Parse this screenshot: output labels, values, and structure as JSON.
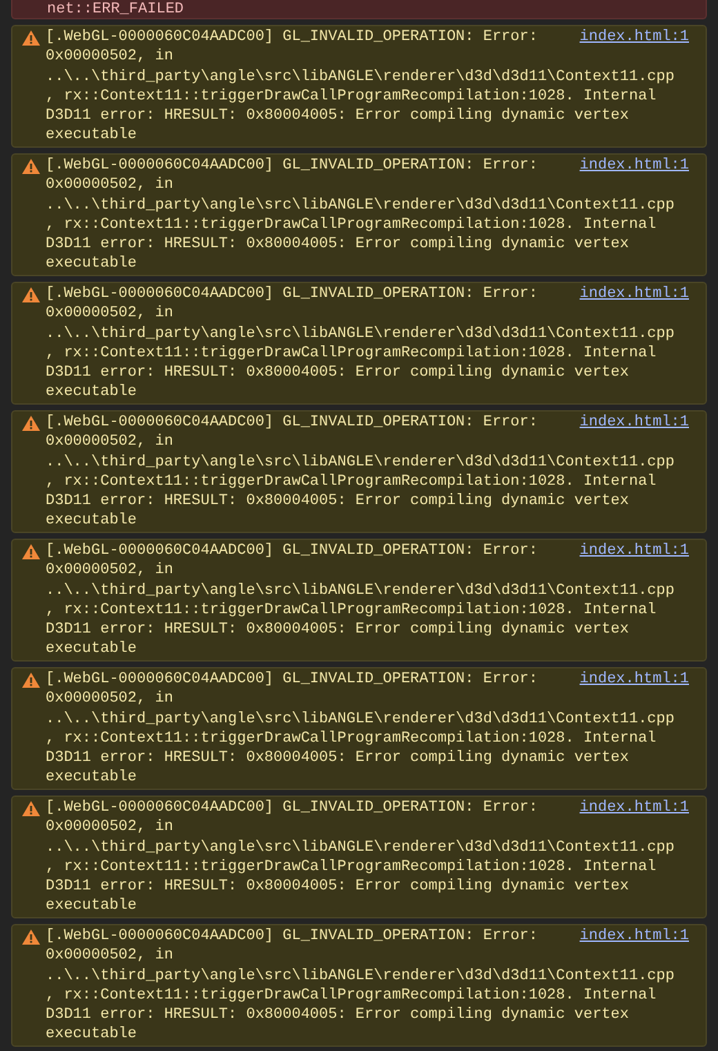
{
  "error_above": {
    "text": "net::ERR_FAILED"
  },
  "messages": [
    {
      "kind": "warning",
      "lines": [
        "[.WebGL-0000060C04AADC00] GL_INVALID_OPERATION: Error:",
        "0x00000502, in",
        "..\\..\\third_party\\angle\\src\\libANGLE\\renderer\\d3d\\d3d11\\Context11.cpp",
        ", rx::Context11::triggerDrawCallProgramRecompilation:1028. Internal",
        "D3D11 error: HRESULT: 0x80004005: Error compiling dynamic vertex",
        "executable"
      ],
      "source": "index.html:1"
    },
    {
      "kind": "warning",
      "lines": [
        "[.WebGL-0000060C04AADC00] GL_INVALID_OPERATION: Error:",
        "0x00000502, in",
        "..\\..\\third_party\\angle\\src\\libANGLE\\renderer\\d3d\\d3d11\\Context11.cpp",
        ", rx::Context11::triggerDrawCallProgramRecompilation:1028. Internal",
        "D3D11 error: HRESULT: 0x80004005: Error compiling dynamic vertex",
        "executable"
      ],
      "source": "index.html:1"
    },
    {
      "kind": "warning",
      "lines": [
        "[.WebGL-0000060C04AADC00] GL_INVALID_OPERATION: Error:",
        "0x00000502, in",
        "..\\..\\third_party\\angle\\src\\libANGLE\\renderer\\d3d\\d3d11\\Context11.cpp",
        ", rx::Context11::triggerDrawCallProgramRecompilation:1028. Internal",
        "D3D11 error: HRESULT: 0x80004005: Error compiling dynamic vertex",
        "executable"
      ],
      "source": "index.html:1"
    },
    {
      "kind": "warning",
      "lines": [
        "[.WebGL-0000060C04AADC00] GL_INVALID_OPERATION: Error:",
        "0x00000502, in",
        "..\\..\\third_party\\angle\\src\\libANGLE\\renderer\\d3d\\d3d11\\Context11.cpp",
        ", rx::Context11::triggerDrawCallProgramRecompilation:1028. Internal",
        "D3D11 error: HRESULT: 0x80004005: Error compiling dynamic vertex",
        "executable"
      ],
      "source": "index.html:1"
    },
    {
      "kind": "warning",
      "lines": [
        "[.WebGL-0000060C04AADC00] GL_INVALID_OPERATION: Error:",
        "0x00000502, in",
        "..\\..\\third_party\\angle\\src\\libANGLE\\renderer\\d3d\\d3d11\\Context11.cpp",
        ", rx::Context11::triggerDrawCallProgramRecompilation:1028. Internal",
        "D3D11 error: HRESULT: 0x80004005: Error compiling dynamic vertex",
        "executable"
      ],
      "source": "index.html:1"
    },
    {
      "kind": "warning",
      "lines": [
        "[.WebGL-0000060C04AADC00] GL_INVALID_OPERATION: Error:",
        "0x00000502, in",
        "..\\..\\third_party\\angle\\src\\libANGLE\\renderer\\d3d\\d3d11\\Context11.cpp",
        ", rx::Context11::triggerDrawCallProgramRecompilation:1028. Internal",
        "D3D11 error: HRESULT: 0x80004005: Error compiling dynamic vertex",
        "executable"
      ],
      "source": "index.html:1"
    },
    {
      "kind": "warning",
      "lines": [
        "[.WebGL-0000060C04AADC00] GL_INVALID_OPERATION: Error:",
        "0x00000502, in",
        "..\\..\\third_party\\angle\\src\\libANGLE\\renderer\\d3d\\d3d11\\Context11.cpp",
        ", rx::Context11::triggerDrawCallProgramRecompilation:1028. Internal",
        "D3D11 error: HRESULT: 0x80004005: Error compiling dynamic vertex",
        "executable"
      ],
      "source": "index.html:1"
    },
    {
      "kind": "warning",
      "lines": [
        "[.WebGL-0000060C04AADC00] GL_INVALID_OPERATION: Error:",
        "0x00000502, in",
        "..\\..\\third_party\\angle\\src\\libANGLE\\renderer\\d3d\\d3d11\\Context11.cpp",
        ", rx::Context11::triggerDrawCallProgramRecompilation:1028. Internal",
        "D3D11 error: HRESULT: 0x80004005: Error compiling dynamic vertex",
        "executable"
      ],
      "source": "index.html:1"
    }
  ]
}
